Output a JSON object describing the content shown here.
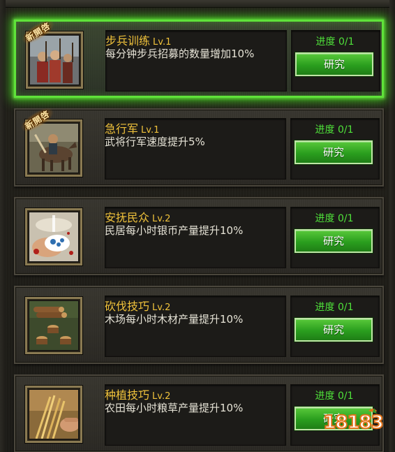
{
  "colors": {
    "title_gold": "#f0c23b",
    "progress_green": "#4fe23a",
    "button_green": "#2a9e1e",
    "active_glow": "#5fe23a",
    "text_light": "#e6e3d6"
  },
  "skills": [
    {
      "name": "步兵训练",
      "level": "Lv.1",
      "description": "每分钟步兵招募的数量增加10%",
      "progress": "进度 0/1",
      "button_label": "研究",
      "badge": "新開啓",
      "icon": "infantry-soldiers-icon",
      "active": true
    },
    {
      "name": "急行军",
      "level": "Lv.1",
      "description": "武将行军速度提升5%",
      "progress": "进度 0/1",
      "button_label": "研究",
      "badge": "新開啓",
      "icon": "cavalry-horse-icon",
      "active": false
    },
    {
      "name": "安抚民众",
      "level": "Lv.2",
      "description": "民居每小时银币产量提升10%",
      "progress": "进度 0/1",
      "button_label": "研究",
      "icon": "silver-coins-bag-icon",
      "active": false
    },
    {
      "name": "砍伐技巧",
      "level": "Lv.2",
      "description": "木场每小时木材产量提升10%",
      "progress": "进度 0/1",
      "button_label": "研究",
      "icon": "lumber-stumps-icon",
      "active": false
    },
    {
      "name": "种植技巧",
      "level": "Lv.2",
      "description": "农田每小时粮草产量提升10%",
      "progress": "进度 0/1",
      "button_label": "研究",
      "icon": "wheat-harvest-icon",
      "active": false
    }
  ],
  "watermark": "18183"
}
